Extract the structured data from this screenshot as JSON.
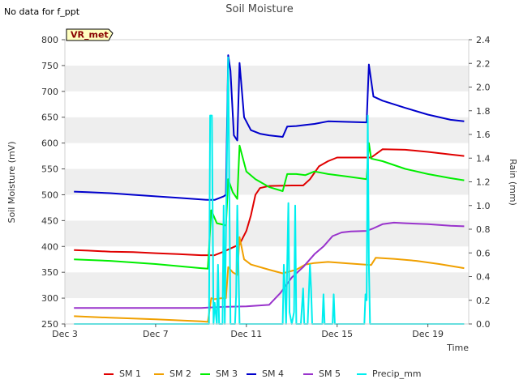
{
  "corner_note": "No data for f_ppt",
  "station_badge": "VR_met",
  "chart_data": {
    "type": "line",
    "title": "Soil Moisture",
    "xlabel": "Time",
    "ylabel": "Soil Moisture (mV)",
    "y2label": "Rain (mm)",
    "x_range_days": [
      3,
      20.8
    ],
    "ylim": [
      250,
      800
    ],
    "y2lim": [
      0.0,
      2.4
    ],
    "x_ticks": [
      {
        "day": 3,
        "label": "Dec 3"
      },
      {
        "day": 7,
        "label": "Dec 7"
      },
      {
        "day": 11,
        "label": "Dec 11"
      },
      {
        "day": 15,
        "label": "Dec 15"
      },
      {
        "day": 19,
        "label": "Dec 19"
      }
    ],
    "y_ticks": [
      250,
      300,
      350,
      400,
      450,
      500,
      550,
      600,
      650,
      700,
      750,
      800
    ],
    "y2_ticks": [
      "0.0",
      "0.2",
      "0.4",
      "0.6",
      "0.8",
      "1.0",
      "1.2",
      "1.4",
      "1.6",
      "1.8",
      "2.0",
      "2.2",
      "2.4"
    ],
    "grid": "horizontal bands",
    "legend_position": "bottom",
    "series": [
      {
        "name": "SM 1",
        "axis": "left",
        "color": "#e00000",
        "points": [
          [
            3.4,
            393
          ],
          [
            4,
            392
          ],
          [
            5,
            390
          ],
          [
            6,
            389
          ],
          [
            7,
            387
          ],
          [
            8,
            385
          ],
          [
            9,
            383
          ],
          [
            9.6,
            383
          ],
          [
            10,
            390
          ],
          [
            10.7,
            404
          ],
          [
            11,
            430
          ],
          [
            11.2,
            460
          ],
          [
            11.4,
            500
          ],
          [
            11.6,
            513
          ],
          [
            12,
            517
          ],
          [
            13,
            518
          ],
          [
            13.5,
            518
          ],
          [
            13.8,
            530
          ],
          [
            14.2,
            555
          ],
          [
            14.6,
            565
          ],
          [
            15,
            572
          ],
          [
            15.5,
            572
          ],
          [
            16,
            572
          ],
          [
            16.5,
            572
          ],
          [
            17,
            588
          ],
          [
            18,
            587
          ],
          [
            19,
            583
          ],
          [
            20,
            578
          ],
          [
            20.6,
            575
          ]
        ]
      },
      {
        "name": "SM 2",
        "axis": "left",
        "color": "#f0a000",
        "points": [
          [
            3.4,
            265
          ],
          [
            5,
            262
          ],
          [
            7,
            259
          ],
          [
            9,
            255
          ],
          [
            9.3,
            254
          ],
          [
            9.45,
            300
          ],
          [
            9.6,
            298
          ],
          [
            9.9,
            300
          ],
          [
            10.1,
            300
          ],
          [
            10.2,
            360
          ],
          [
            10.4,
            350
          ],
          [
            10.6,
            345
          ],
          [
            10.7,
            418
          ],
          [
            10.9,
            375
          ],
          [
            11.2,
            365
          ],
          [
            12,
            355
          ],
          [
            12.6,
            348
          ],
          [
            13.2,
            355
          ],
          [
            13.6,
            365
          ],
          [
            14,
            368
          ],
          [
            14.6,
            370
          ],
          [
            15.5,
            367
          ],
          [
            16.5,
            364
          ],
          [
            16.7,
            378
          ],
          [
            17.5,
            376
          ],
          [
            18.5,
            372
          ],
          [
            19.5,
            366
          ],
          [
            20.6,
            358
          ]
        ]
      },
      {
        "name": "SM 3",
        "axis": "left",
        "color": "#00ee00",
        "points": [
          [
            3.4,
            375
          ],
          [
            5,
            372
          ],
          [
            7,
            366
          ],
          [
            9,
            358
          ],
          [
            9.3,
            357
          ],
          [
            9.45,
            470
          ],
          [
            9.7,
            445
          ],
          [
            10,
            442
          ],
          [
            10.1,
            440
          ],
          [
            10.2,
            530
          ],
          [
            10.4,
            505
          ],
          [
            10.6,
            492
          ],
          [
            10.7,
            595
          ],
          [
            11,
            545
          ],
          [
            11.4,
            530
          ],
          [
            12,
            515
          ],
          [
            12.6,
            507
          ],
          [
            12.8,
            540
          ],
          [
            13.2,
            540
          ],
          [
            13.6,
            538
          ],
          [
            14,
            545
          ],
          [
            14.6,
            540
          ],
          [
            15.5,
            535
          ],
          [
            16.3,
            530
          ],
          [
            16.4,
            600
          ],
          [
            16.5,
            570
          ],
          [
            17,
            565
          ],
          [
            18,
            550
          ],
          [
            19,
            540
          ],
          [
            20,
            532
          ],
          [
            20.6,
            528
          ]
        ]
      },
      {
        "name": "SM 4",
        "axis": "left",
        "color": "#0000cc",
        "points": [
          [
            3.4,
            506
          ],
          [
            4,
            505
          ],
          [
            5,
            503
          ],
          [
            6,
            500
          ],
          [
            7,
            497
          ],
          [
            8,
            494
          ],
          [
            9,
            491
          ],
          [
            9.3,
            490
          ],
          [
            9.6,
            490
          ],
          [
            10,
            497
          ],
          [
            10.1,
            500
          ],
          [
            10.2,
            770
          ],
          [
            10.3,
            740
          ],
          [
            10.45,
            615
          ],
          [
            10.6,
            605
          ],
          [
            10.7,
            755
          ],
          [
            10.9,
            650
          ],
          [
            11.2,
            625
          ],
          [
            11.6,
            618
          ],
          [
            12,
            615
          ],
          [
            12.6,
            612
          ],
          [
            12.8,
            632
          ],
          [
            13.2,
            633
          ],
          [
            13.6,
            635
          ],
          [
            14,
            637
          ],
          [
            14.6,
            642
          ],
          [
            15.5,
            641
          ],
          [
            16.3,
            640
          ],
          [
            16.4,
            752
          ],
          [
            16.6,
            690
          ],
          [
            17,
            682
          ],
          [
            18,
            668
          ],
          [
            19,
            655
          ],
          [
            20,
            645
          ],
          [
            20.6,
            642
          ]
        ]
      },
      {
        "name": "SM 5",
        "axis": "left",
        "color": "#9933cc",
        "points": [
          [
            3.4,
            281
          ],
          [
            5,
            281
          ],
          [
            7,
            281
          ],
          [
            9,
            281
          ],
          [
            10,
            283
          ],
          [
            11,
            284
          ],
          [
            12,
            287
          ],
          [
            12.5,
            310
          ],
          [
            13,
            340
          ],
          [
            13.5,
            360
          ],
          [
            14,
            385
          ],
          [
            14.4,
            400
          ],
          [
            14.8,
            420
          ],
          [
            15.2,
            427
          ],
          [
            15.6,
            429
          ],
          [
            16.3,
            430
          ],
          [
            16.6,
            435
          ],
          [
            17,
            443
          ],
          [
            17.5,
            446
          ],
          [
            18,
            445
          ],
          [
            19,
            443
          ],
          [
            20,
            440
          ],
          [
            20.6,
            439
          ]
        ]
      },
      {
        "name": "Precip_mm",
        "axis": "right",
        "color": "#00eeee",
        "points": [
          [
            3.4,
            0
          ],
          [
            9.35,
            0
          ],
          [
            9.4,
            1.76
          ],
          [
            9.48,
            1.76
          ],
          [
            9.55,
            0
          ],
          [
            9.6,
            0.18
          ],
          [
            9.7,
            0
          ],
          [
            9.75,
            0.5
          ],
          [
            9.8,
            0
          ],
          [
            9.95,
            0
          ],
          [
            10,
            1.0
          ],
          [
            10.05,
            0
          ],
          [
            10.2,
            2.25
          ],
          [
            10.3,
            0
          ],
          [
            10.5,
            0
          ],
          [
            10.55,
            0.25
          ],
          [
            10.6,
            1.0
          ],
          [
            10.65,
            0.5
          ],
          [
            10.7,
            0
          ],
          [
            12.6,
            0
          ],
          [
            12.65,
            0.5
          ],
          [
            12.7,
            0.3
          ],
          [
            12.75,
            0
          ],
          [
            12.85,
            1.02
          ],
          [
            12.9,
            0.1
          ],
          [
            13,
            0
          ],
          [
            13.1,
            0.1
          ],
          [
            13.15,
            1.0
          ],
          [
            13.2,
            0
          ],
          [
            13.4,
            0
          ],
          [
            13.5,
            0.3
          ],
          [
            13.55,
            0
          ],
          [
            13.7,
            0
          ],
          [
            13.8,
            0.5
          ],
          [
            13.85,
            0.3
          ],
          [
            13.9,
            0
          ],
          [
            14.35,
            0
          ],
          [
            14.4,
            0.25
          ],
          [
            14.45,
            0
          ],
          [
            14.8,
            0
          ],
          [
            14.85,
            0.25
          ],
          [
            14.9,
            0
          ],
          [
            16.2,
            0
          ],
          [
            16.25,
            0.25
          ],
          [
            16.3,
            0.2
          ],
          [
            16.35,
            1.76
          ],
          [
            16.4,
            0.5
          ],
          [
            16.45,
            0
          ],
          [
            20.6,
            0
          ]
        ]
      }
    ]
  }
}
